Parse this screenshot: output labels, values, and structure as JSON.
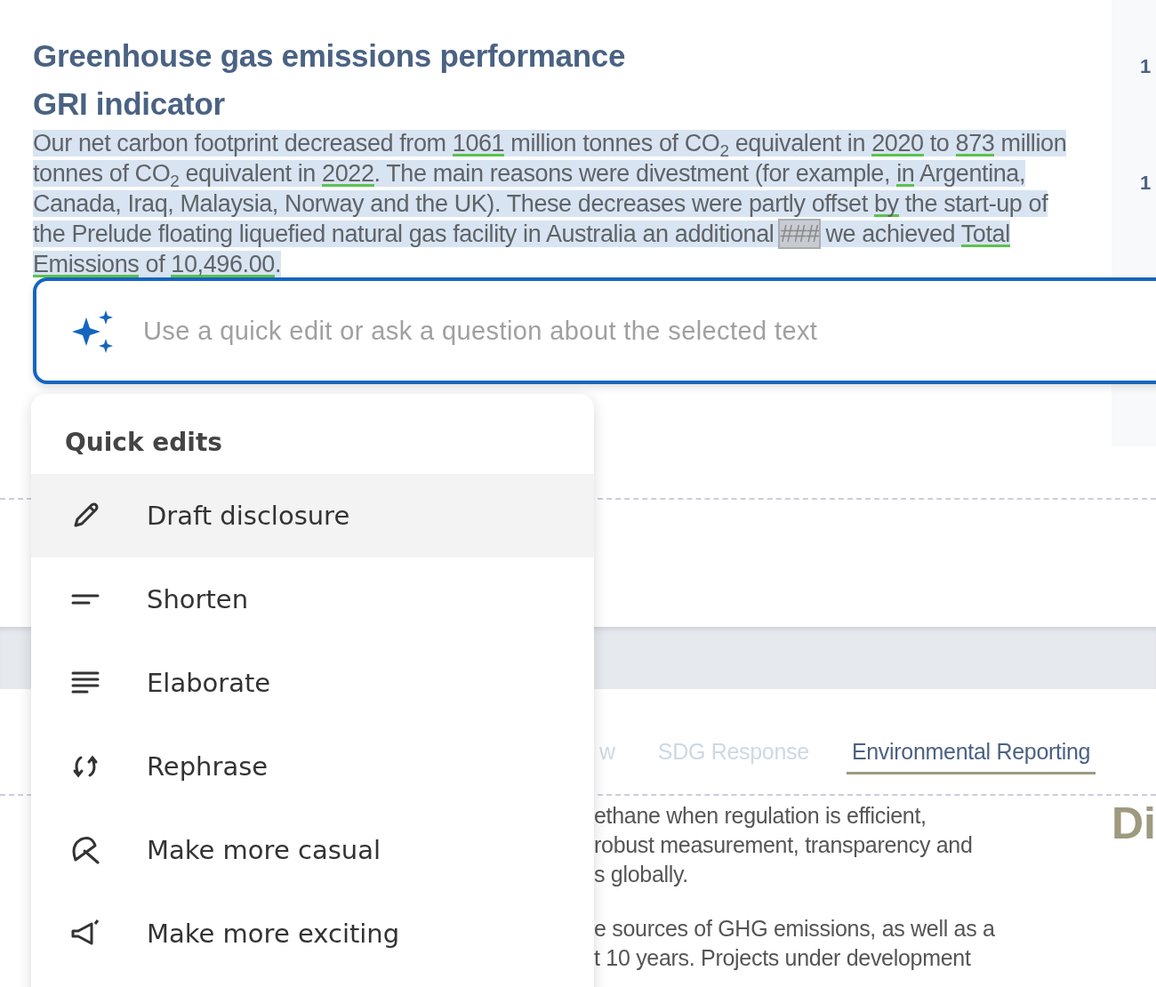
{
  "document": {
    "title_lines": [
      "Greenhouse gas emissions performance",
      "GRI indicator"
    ],
    "paragraph": [
      {
        "kind": "plain",
        "text": "Our net carbon footprint decreased from "
      },
      {
        "kind": "underlined",
        "text": "1061"
      },
      {
        "kind": "plain",
        "text": " million tonnes of CO$_{2}$ equivalent in "
      },
      {
        "kind": "underlined",
        "text": "2020"
      },
      {
        "kind": "plain",
        "text": " to "
      },
      {
        "kind": "underlined",
        "text": "873"
      },
      {
        "kind": "plain",
        "text": " million tonnes of CO$_{2}$ equivalent in "
      },
      {
        "kind": "underlined",
        "text": "2022"
      },
      {
        "kind": "plain",
        "text": ". The main reasons were divestment (for example, "
      },
      {
        "kind": "underlined",
        "text": "in"
      },
      {
        "kind": "plain",
        "text": " Argentina, Canada, Iraq, Malaysia, Norway and the UK). These decreases were partly offset "
      },
      {
        "kind": "underlined",
        "text": "by"
      },
      {
        "kind": "plain",
        "text": " the start-up of the Prelude floating liquefied natural gas facility in Australia an additional "
      },
      {
        "kind": "tag",
        "text": "###"
      },
      {
        "kind": "plain",
        "text": " we achieved "
      },
      {
        "kind": "underlined",
        "text": "Total Emissions"
      },
      {
        "kind": "plain",
        "text": " of "
      },
      {
        "kind": "underlined",
        "text": "10,496.00"
      },
      {
        "kind": "plain",
        "text": "."
      }
    ]
  },
  "side_panel": {
    "values": [
      "1",
      "1"
    ]
  },
  "assistant_field": {
    "placeholder": "Use a quick edit or ask a question about the selected text"
  },
  "quick_edits": {
    "heading": "Quick edits",
    "items": [
      {
        "kind": "pencil",
        "label": "Draft disclosure",
        "selected": true
      },
      {
        "kind": "short-lines",
        "label": "Shorten",
        "selected": false
      },
      {
        "kind": "long-lines",
        "label": "Elaborate",
        "selected": false
      },
      {
        "kind": "rephrase",
        "label": "Rephrase",
        "selected": false
      },
      {
        "kind": "casual",
        "label": "Make more casual",
        "selected": false
      },
      {
        "kind": "exciting",
        "label": "Make more exciting",
        "selected": false
      }
    ]
  },
  "tabs": [
    {
      "label": "w",
      "selected": false
    },
    {
      "label": "SDG Response",
      "selected": false
    },
    {
      "label": "Environmental Reporting",
      "selected": true
    }
  ],
  "section": {
    "paragraphs": [
      [
        "ethane when regulation is efficient,",
        "robust measurement, transparency and",
        "s globally."
      ],
      [
        "e sources of GHG emissions, as well as a",
        "t 10 years. Projects under development"
      ]
    ],
    "heading": "Di"
  }
}
